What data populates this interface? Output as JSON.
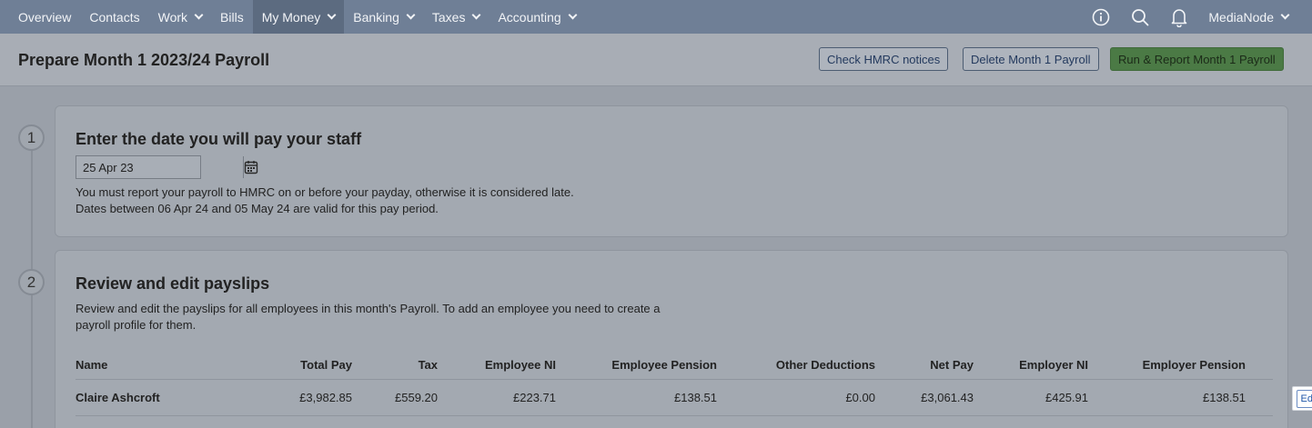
{
  "nav": {
    "items": [
      {
        "label": "Overview",
        "dropdown": false
      },
      {
        "label": "Contacts",
        "dropdown": false
      },
      {
        "label": "Work",
        "dropdown": true
      },
      {
        "label": "Bills",
        "dropdown": false
      },
      {
        "label": "My Money",
        "dropdown": true,
        "active": true
      },
      {
        "label": "Banking",
        "dropdown": true
      },
      {
        "label": "Taxes",
        "dropdown": true
      },
      {
        "label": "Accounting",
        "dropdown": true
      }
    ],
    "icons": [
      "info-icon",
      "search-icon",
      "bell-icon"
    ],
    "user": "MediaNode"
  },
  "header": {
    "title": "Prepare Month 1 2023/24 Payroll",
    "check_hmrc": "Check HMRC notices",
    "delete_payroll": "Delete Month 1 Payroll",
    "run_report": "Run & Report Month 1 Payroll"
  },
  "step1": {
    "number": "1",
    "title": "Enter the date you will pay your staff",
    "date_value": "25 Apr 23",
    "note_line1": "You must report your payroll to HMRC on or before your payday, otherwise it is considered late.",
    "note_line2": "Dates between 06 Apr 24 and 05 May 24 are valid for this pay period."
  },
  "step2": {
    "number": "2",
    "title": "Review and edit payslips",
    "desc_line1": "Review and edit the payslips for all employees in this month's Payroll. To add an employee you need to create a",
    "desc_line2": "payroll profile for them.",
    "columns": {
      "name": "Name",
      "total_pay": "Total Pay",
      "tax": "Tax",
      "employee_ni": "Employee NI",
      "employee_pension": "Employee Pension",
      "other_deductions": "Other Deductions",
      "net_pay": "Net Pay",
      "employer_ni": "Employer NI",
      "employer_pension": "Employer Pension"
    },
    "rows": [
      {
        "name": "Claire Ashcroft",
        "total_pay": "£3,982.85",
        "tax": "£559.20",
        "employee_ni": "£223.71",
        "employee_pension": "£138.51",
        "other_deductions": "£0.00",
        "net_pay": "£3,061.43",
        "employer_ni": "£425.91",
        "employer_pension": "£138.51",
        "edit_label": "Edit Payslip"
      }
    ]
  },
  "colors": {
    "nav_bg": "#6f7f96",
    "primary_button": "#4b7a45",
    "link": "#1d55a8"
  }
}
